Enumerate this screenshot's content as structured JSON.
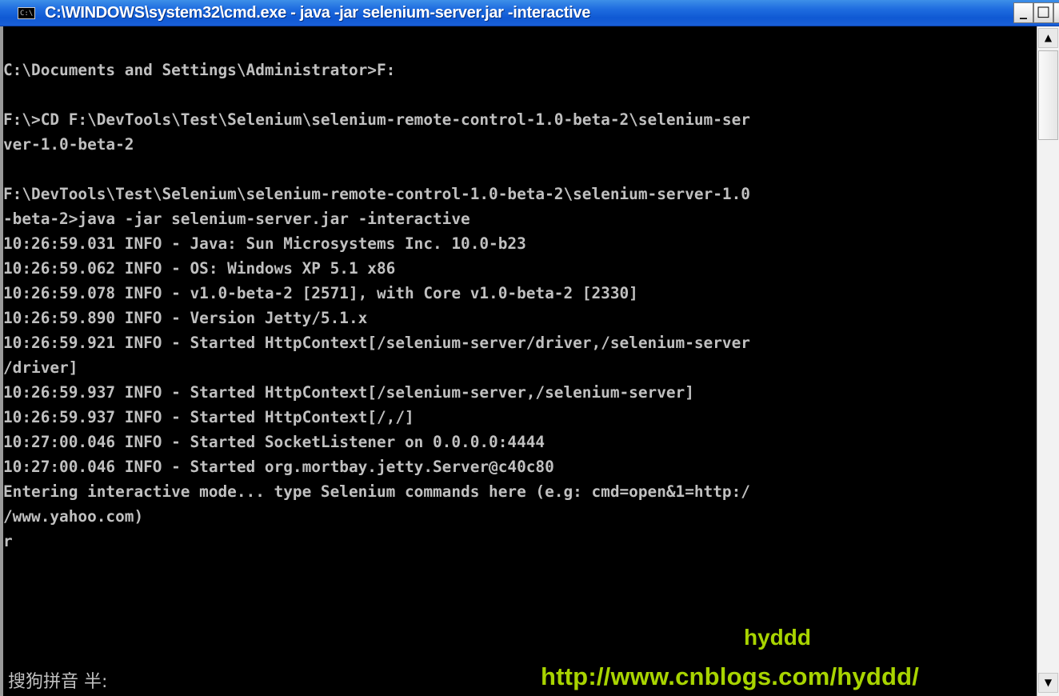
{
  "window": {
    "title": "C:\\WINDOWS\\system32\\cmd.exe - java -jar selenium-server.jar -interactive",
    "icon_text": "C:\\",
    "minimize_label": "_",
    "maximize_label": "□",
    "close_label": "×"
  },
  "console": {
    "lines": [
      "C:\\Documents and Settings\\Administrator>F:",
      "",
      "F:\\>CD F:\\DevTools\\Test\\Selenium\\selenium-remote-control-1.0-beta-2\\selenium-ser",
      "ver-1.0-beta-2",
      "",
      "F:\\DevTools\\Test\\Selenium\\selenium-remote-control-1.0-beta-2\\selenium-server-1.0",
      "-beta-2>java -jar selenium-server.jar -interactive",
      "10:26:59.031 INFO - Java: Sun Microsystems Inc. 10.0-b23",
      "10:26:59.062 INFO - OS: Windows XP 5.1 x86",
      "10:26:59.078 INFO - v1.0-beta-2 [2571], with Core v1.0-beta-2 [2330]",
      "10:26:59.890 INFO - Version Jetty/5.1.x",
      "10:26:59.921 INFO - Started HttpContext[/selenium-server/driver,/selenium-server",
      "/driver]",
      "10:26:59.937 INFO - Started HttpContext[/selenium-server,/selenium-server]",
      "10:26:59.937 INFO - Started HttpContext[/,/]",
      "10:27:00.046 INFO - Started SocketListener on 0.0.0.0:4444",
      "10:27:00.046 INFO - Started org.mortbay.jetty.Server@c40c80",
      "Entering interactive mode... type Selenium commands here (e.g: cmd=open&1=http:/",
      "/www.yahoo.com)",
      "r"
    ]
  },
  "scrollbar": {
    "up_icon": "▲",
    "down_icon": "▼"
  },
  "ime_status": "搜狗拼音 半:",
  "watermark": {
    "name": "hyddd",
    "url": "http://www.cnblogs.com/hyddd/"
  }
}
